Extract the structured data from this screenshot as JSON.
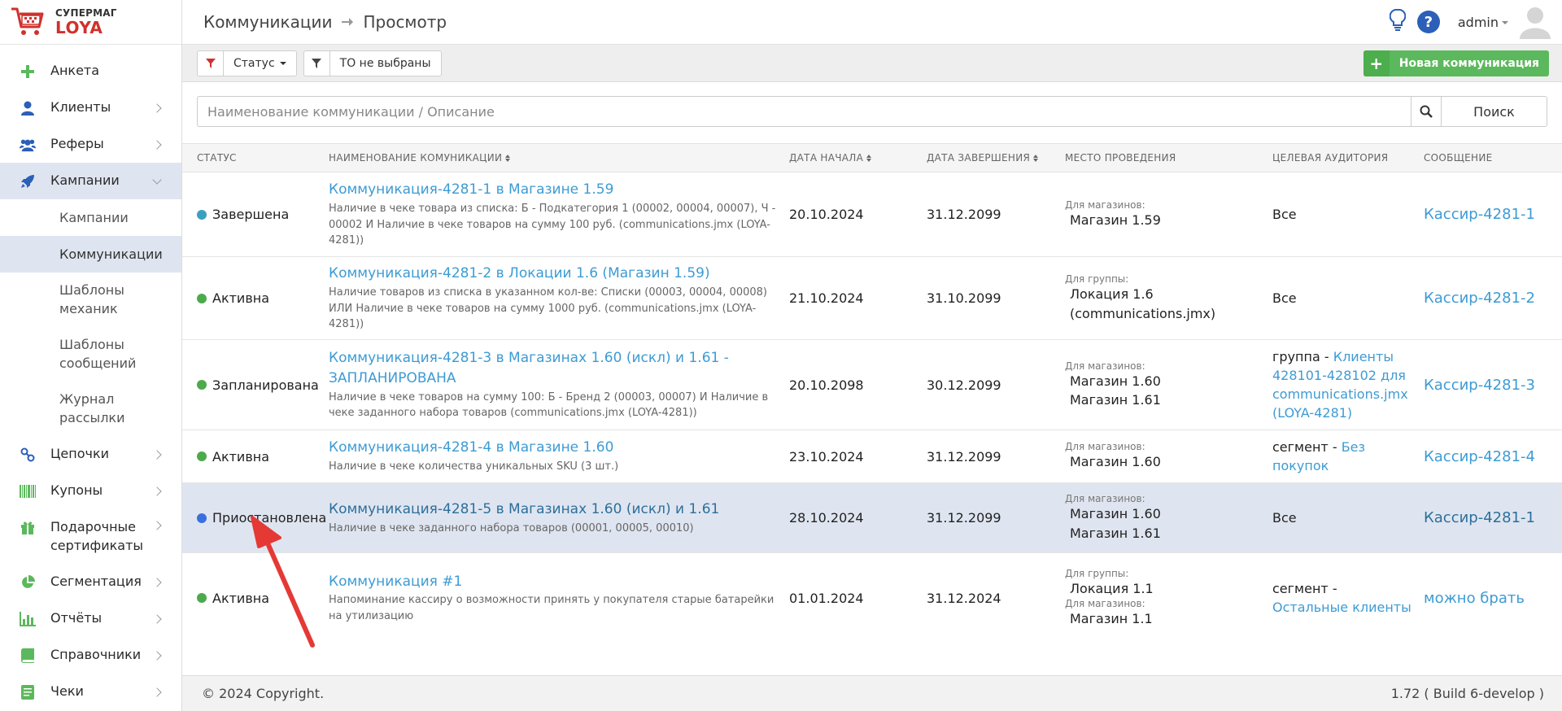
{
  "logo": {
    "top": "СУПЕРМАГ",
    "bottom": "LOYA"
  },
  "sidebar": {
    "items": [
      {
        "label": "Анкета",
        "icon": "plus-icon"
      },
      {
        "label": "Клиенты",
        "icon": "user-icon"
      },
      {
        "label": "Реферы",
        "icon": "users-icon"
      },
      {
        "label": "Кампании",
        "icon": "rocket-icon",
        "active": true
      },
      {
        "label": "Цепочки",
        "icon": "chain-icon"
      },
      {
        "label": "Купоны",
        "icon": "barcode-icon"
      },
      {
        "label": "Подарочные сертификаты",
        "icon": "gift-icon"
      },
      {
        "label": "Сегментация",
        "icon": "pie-chart-icon"
      },
      {
        "label": "Отчёты",
        "icon": "bar-chart-icon"
      },
      {
        "label": "Справочники",
        "icon": "book-icon"
      },
      {
        "label": "Чеки",
        "icon": "receipt-icon"
      }
    ],
    "sub_items": [
      {
        "label": "Кампании"
      },
      {
        "label": "Коммуникации",
        "active": true
      },
      {
        "label": "Шаблоны механик"
      },
      {
        "label": "Шаблоны сообщений"
      },
      {
        "label": "Журнал рассылки"
      }
    ]
  },
  "header": {
    "crumb1": "Коммуникации",
    "crumb2": "Просмотр",
    "user": "admin"
  },
  "toolbar": {
    "status_filter": "Статус",
    "to_filter": "ТО не выбраны",
    "new_button": "Новая коммуникация"
  },
  "search": {
    "placeholder": "Наименование коммуникации / Описание",
    "button": "Поиск"
  },
  "table": {
    "headers": {
      "status": "СТАТУС",
      "name": "НАИМЕНОВАНИЕ КОМУНИКАЦИИ",
      "start": "ДАТА НАЧАЛА",
      "end": "ДАТА ЗАВЕРШЕНИЯ",
      "place": "МЕСТО ПРОВЕДЕНИЯ",
      "audience": "ЦЕЛЕВАЯ АУДИТОРИЯ",
      "message": "СООБЩЕНИЕ"
    },
    "rows": [
      {
        "status": "Завершена",
        "status_color": "#3aa0c2",
        "name": "Коммуникация-4281-1 в Магазине 1.59",
        "desc": "Наличие в чеке товара из списка: Б - Подкатегория 1 (00002, 00004, 00007), Ч - 00002 И Наличие в чеке товаров на сумму 100 руб. (communications.jmx (LOYA-4281))",
        "start": "20.10.2024",
        "end": "31.12.2099",
        "place_label": "Для магазинов:",
        "place": "Магазин 1.59",
        "audience": "Все",
        "message": "Кассир-4281-1"
      },
      {
        "status": "Активна",
        "status_color": "#4caa4c",
        "name": "Коммуникация-4281-2 в Локации 1.6 (Магазин 1.59)",
        "desc": "Наличие товаров из списка в указанном кол-ве: Списки (00003, 00004, 00008) ИЛИ Наличие в чеке товаров на сумму 1000 руб. (communications.jmx (LOYA-4281))",
        "start": "21.10.2024",
        "end": "31.10.2099",
        "place_label": "Для группы:",
        "place": "Локация 1.6 (communications.jmx)",
        "audience": "Все",
        "message": "Кассир-4281-2"
      },
      {
        "status": "Запланирована",
        "status_color": "#4caa4c",
        "name": "Коммуникация-4281-3 в Магазинах 1.60 (искл) и 1.61 - ЗАПЛАНИРОВАНА",
        "desc": "Наличие в чеке товаров на сумму 100: Б - Бренд 2 (00003, 00007) И Наличие в чеке заданного набора товаров (communications.jmx (LOYA-4281))",
        "start": "20.10.2098",
        "end": "30.12.2099",
        "place_label": "Для магазинов:",
        "place": "Магазин 1.60",
        "place2": "Магазин 1.61",
        "audience_prefix": "группа - ",
        "audience_link": "Клиенты 428101-428102 для communications.jmx (LOYA-4281)",
        "message": "Кассир-4281-3"
      },
      {
        "status": "Активна",
        "status_color": "#4caa4c",
        "name": "Коммуникация-4281-4 в Магазине 1.60",
        "desc": "Наличие в чеке количества уникальных SKU (3 шт.)",
        "start": "23.10.2024",
        "end": "31.12.2099",
        "place_label": "Для магазинов:",
        "place": "Магазин 1.60",
        "audience_prefix": "сегмент - ",
        "audience_link": "Без покупок",
        "message": "Кассир-4281-4"
      },
      {
        "status": "Приостановлена",
        "status_color": "#3b6fe0",
        "name": "Коммуникация-4281-5 в Магазинах 1.60 (искл) и 1.61",
        "desc": "Наличие в чеке заданного набора товаров (00001, 00005, 00010)",
        "start": "28.10.2024",
        "end": "31.12.2099",
        "place_label": "Для магазинов:",
        "place": "Магазин 1.60",
        "place2": "Магазин 1.61",
        "audience": "Все",
        "message": "Кассир-4281-1"
      },
      {
        "status": "Активна",
        "status_color": "#4caa4c",
        "name": "Коммуникация #1",
        "desc": "Напоминание кассиру о возможности принять у покупателя старые батарейки на утилизацию",
        "start": "01.01.2024",
        "end": "31.12.2024",
        "place_label": "Для группы:",
        "place": "Локация 1.1",
        "place_label2": "Для магазинов:",
        "place2": "Магазин 1.1",
        "audience_prefix": "сегмент - ",
        "audience_link": "Остальные клиенты",
        "message": "можно брать"
      }
    ]
  },
  "footer": {
    "copyright": "© 2024 Copyright.",
    "version": "1.72 ( Build 6-develop )"
  },
  "colors": {
    "link": "#3d9bd4",
    "active_bg": "#dfe5f0",
    "green_button": "#5cb85c",
    "arrow": "#e53935"
  }
}
